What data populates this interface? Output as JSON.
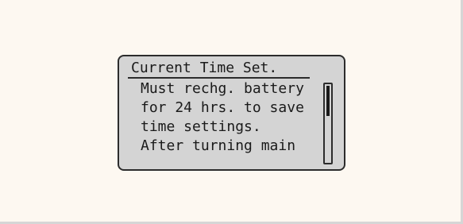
{
  "display": {
    "title": "Current Time Set.",
    "lines": [
      "Must rechg. battery",
      "for 24 hrs. to save",
      "time settings.",
      "After turning main"
    ],
    "scroll_position": 0.0,
    "scroll_visible_fraction": 0.4
  },
  "colors": {
    "background": "#fdf8f1",
    "lcd_background": "#d4d4d4",
    "lcd_text": "#1a1a1a",
    "lcd_border": "#2c2c2c"
  }
}
